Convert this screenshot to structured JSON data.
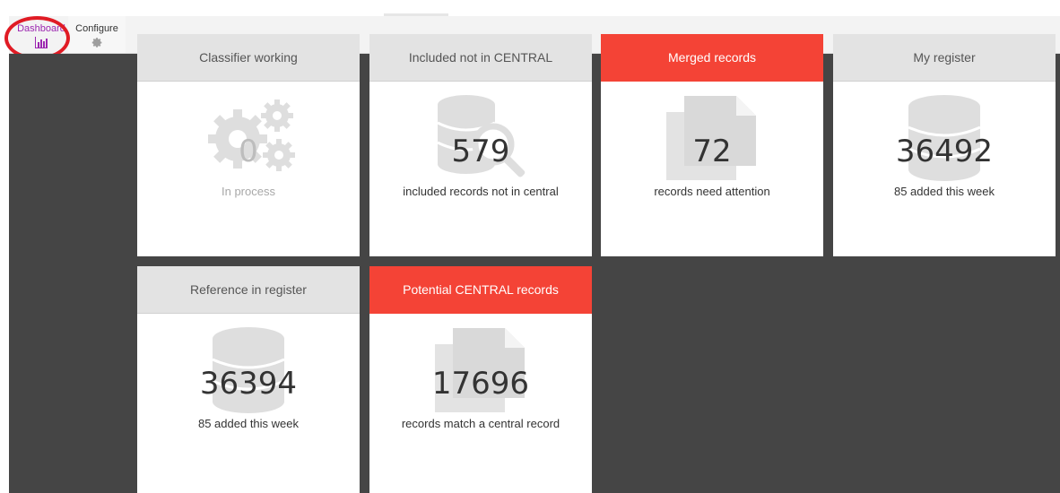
{
  "tabs": [
    {
      "label": "Dashboard",
      "icon": "bar-chart-icon",
      "active": true,
      "color": "#9c27b0"
    },
    {
      "label": "Configure",
      "icon": "gear-icon",
      "active": false
    }
  ],
  "cards": [
    {
      "title": "Classifier working",
      "value": "0",
      "caption": "In process",
      "icon": "gears-icon",
      "header": "grey"
    },
    {
      "title": "Included not in CENTRAL",
      "value": "579",
      "caption": "included records not in central",
      "icon": "database-search-icon",
      "header": "grey"
    },
    {
      "title": "Merged records",
      "value": "72",
      "caption": "records need attention",
      "icon": "files-icon",
      "header": "red"
    },
    {
      "title": "My register",
      "value": "36492",
      "caption": "85 added this week",
      "icon": "database-icon",
      "header": "grey"
    },
    {
      "title": "Reference in register",
      "value": "36394",
      "caption": "85 added this week",
      "icon": "database-icon",
      "header": "grey"
    },
    {
      "title": "Potential CENTRAL records",
      "value": "17696",
      "caption": "records match a central record",
      "icon": "files-icon",
      "header": "red"
    }
  ],
  "colors": {
    "red_header": "#f44336",
    "grey_header": "#e3e3e3",
    "background": "#454545",
    "annotation": "#e01b24"
  }
}
